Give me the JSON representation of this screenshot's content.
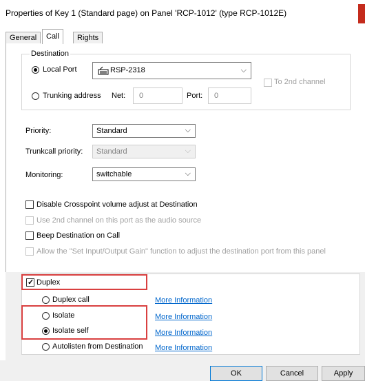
{
  "window": {
    "title": "Properties of Key 1 (Standard page) on Panel 'RCP-1012' (type RCP-1012E)"
  },
  "tabs": [
    {
      "label": "General"
    },
    {
      "label": "Call"
    },
    {
      "label": "Rights"
    }
  ],
  "destination": {
    "group_label": "Destination",
    "local_port_label": "Local Port",
    "local_port_value": "RSP-2318",
    "to_2nd_channel_label": "To 2nd channel",
    "trunking_label": "Trunking address",
    "net_label": "Net:",
    "net_value": "0",
    "port_label": "Port:",
    "port_value": "0"
  },
  "settings": {
    "priority_label": "Priority:",
    "priority_value": "Standard",
    "trunk_priority_label": "Trunkcall priority:",
    "trunk_priority_value": "Standard",
    "monitoring_label": "Monitoring:",
    "monitoring_value": "switchable"
  },
  "options": {
    "disable_crosspoint": "Disable Crosspoint volume adjust at Destination",
    "use_2nd_channel": "Use 2nd channel on this port as the audio source",
    "beep_destination": "Beep Destination on Call",
    "allow_gain": "Allow the \"Set Input/Output Gain\" function to adjust the destination port from this panel"
  },
  "duplex": {
    "duplex_label": "Duplex",
    "duplex_call_label": "Duplex call",
    "isolate_label": "Isolate",
    "isolate_self_label": "Isolate self",
    "autolisten_label": "Autolisten from Destination",
    "more_info": "More Information"
  },
  "footer": {
    "ok": "OK",
    "cancel": "Cancel",
    "apply": "Apply"
  }
}
